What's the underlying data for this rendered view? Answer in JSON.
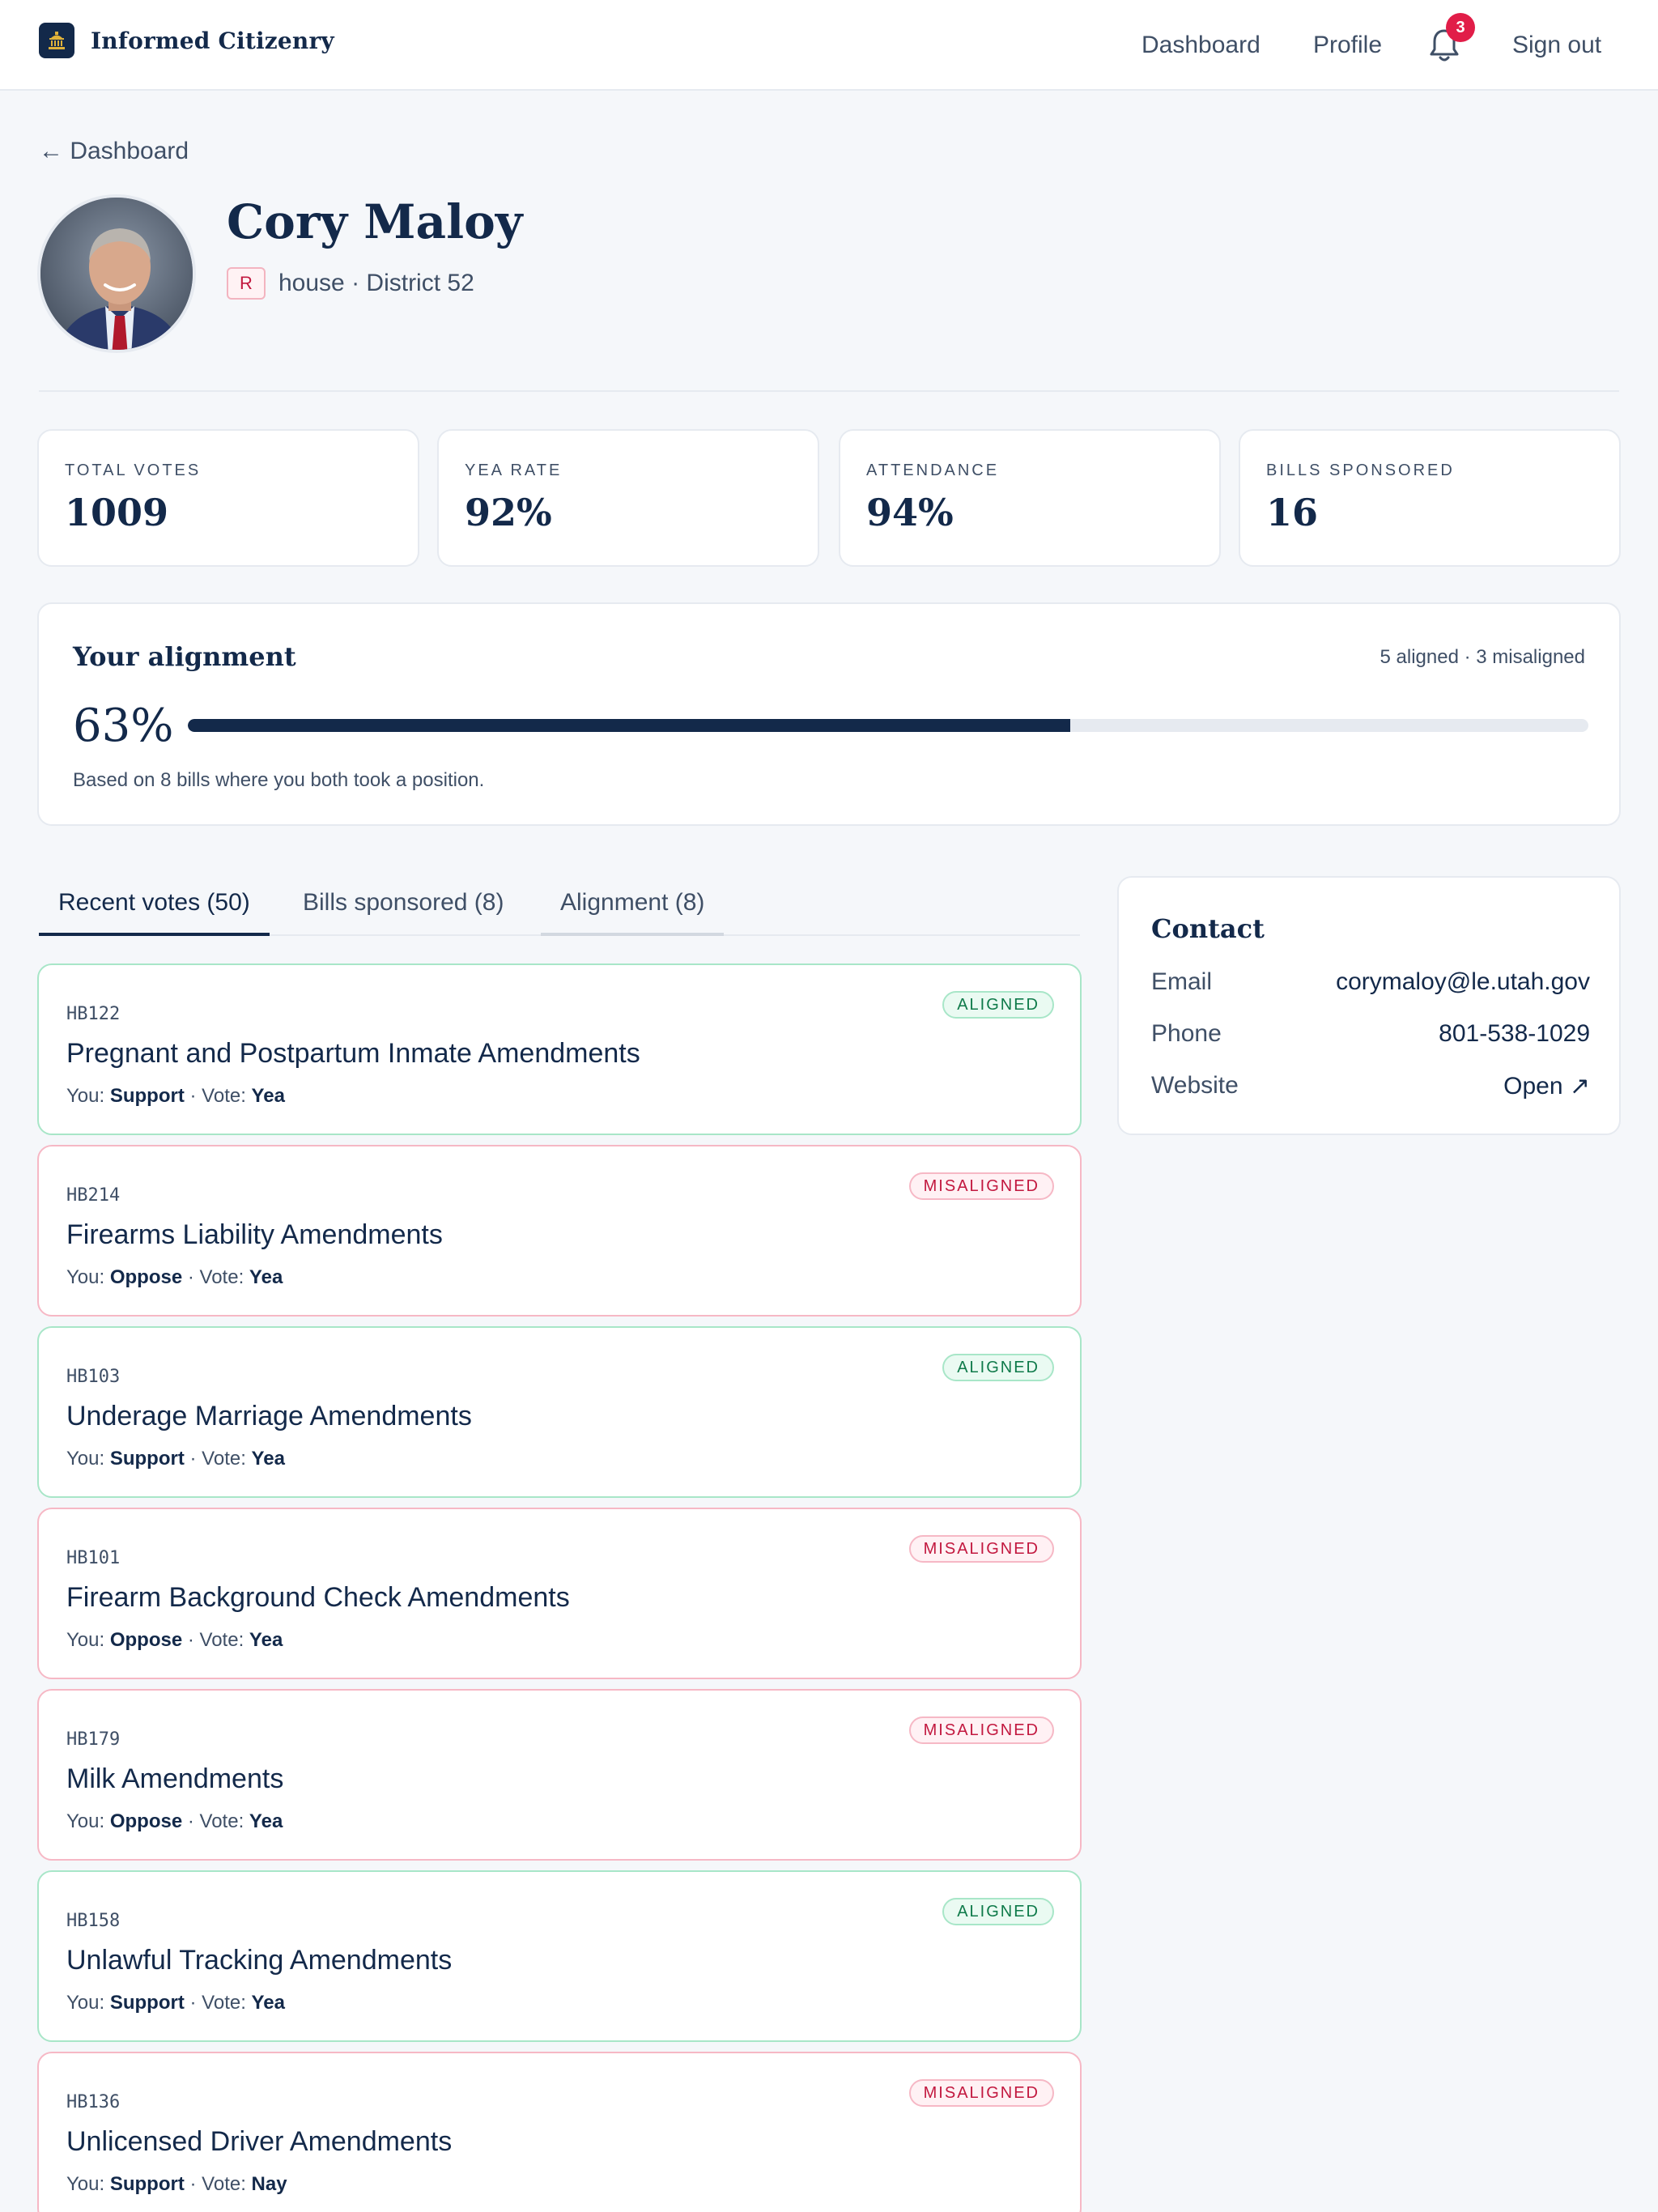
{
  "header": {
    "brand": "Informed Citizenry",
    "nav": {
      "dashboard": "Dashboard",
      "profile": "Profile",
      "notifications_count": "3",
      "sign_out": "Sign out"
    }
  },
  "back_link": "← Dashboard",
  "rep": {
    "name": "Cory Maloy",
    "party": "R",
    "meta": "house · District 52"
  },
  "stats": [
    {
      "label": "TOTAL VOTES",
      "value": "1009"
    },
    {
      "label": "YEA RATE",
      "value": "92%"
    },
    {
      "label": "ATTENDANCE",
      "value": "94%"
    },
    {
      "label": "BILLS SPONSORED",
      "value": "16"
    }
  ],
  "alignment": {
    "title": "Your alignment",
    "counts": "5 aligned · 3 misaligned",
    "percent_label": "63%",
    "percent": 63,
    "note": "Based on 8 bills where you both took a position."
  },
  "tabs": [
    {
      "label": "Recent votes (50)"
    },
    {
      "label": "Bills sponsored (8)"
    },
    {
      "label": "Alignment (8)"
    }
  ],
  "votes": [
    {
      "id": "HB122",
      "title": "Pregnant and Postpartum Inmate Amendments",
      "status": "ALIGNED",
      "you_label": "You:",
      "you": "Support",
      "vote_label": "· Vote:",
      "vote": "Yea"
    },
    {
      "id": "HB214",
      "title": "Firearms Liability Amendments",
      "status": "MISALIGNED",
      "you_label": "You:",
      "you": "Oppose",
      "vote_label": "· Vote:",
      "vote": "Yea"
    },
    {
      "id": "HB103",
      "title": "Underage Marriage Amendments",
      "status": "ALIGNED",
      "you_label": "You:",
      "you": "Support",
      "vote_label": "· Vote:",
      "vote": "Yea"
    },
    {
      "id": "HB101",
      "title": "Firearm Background Check Amendments",
      "status": "MISALIGNED",
      "you_label": "You:",
      "you": "Oppose",
      "vote_label": "· Vote:",
      "vote": "Yea"
    },
    {
      "id": "HB179",
      "title": "Milk Amendments",
      "status": "MISALIGNED",
      "you_label": "You:",
      "you": "Oppose",
      "vote_label": "· Vote:",
      "vote": "Yea"
    },
    {
      "id": "HB158",
      "title": "Unlawful Tracking Amendments",
      "status": "ALIGNED",
      "you_label": "You:",
      "you": "Support",
      "vote_label": "· Vote:",
      "vote": "Yea"
    },
    {
      "id": "HB136",
      "title": "Unlicensed Driver Amendments",
      "status": "MISALIGNED",
      "you_label": "You:",
      "you": "Support",
      "vote_label": "· Vote:",
      "vote": "Nay"
    }
  ],
  "contact": {
    "title": "Contact",
    "email_label": "Email",
    "email": "corymaloy@le.utah.gov",
    "phone_label": "Phone",
    "phone": "801-538-1029",
    "website_label": "Website",
    "website": "Open ↗"
  },
  "colors": {
    "navy": "#13294a",
    "aligned": "#0f7a4a",
    "misaligned": "#c2183f",
    "badge": "#e11d48"
  }
}
